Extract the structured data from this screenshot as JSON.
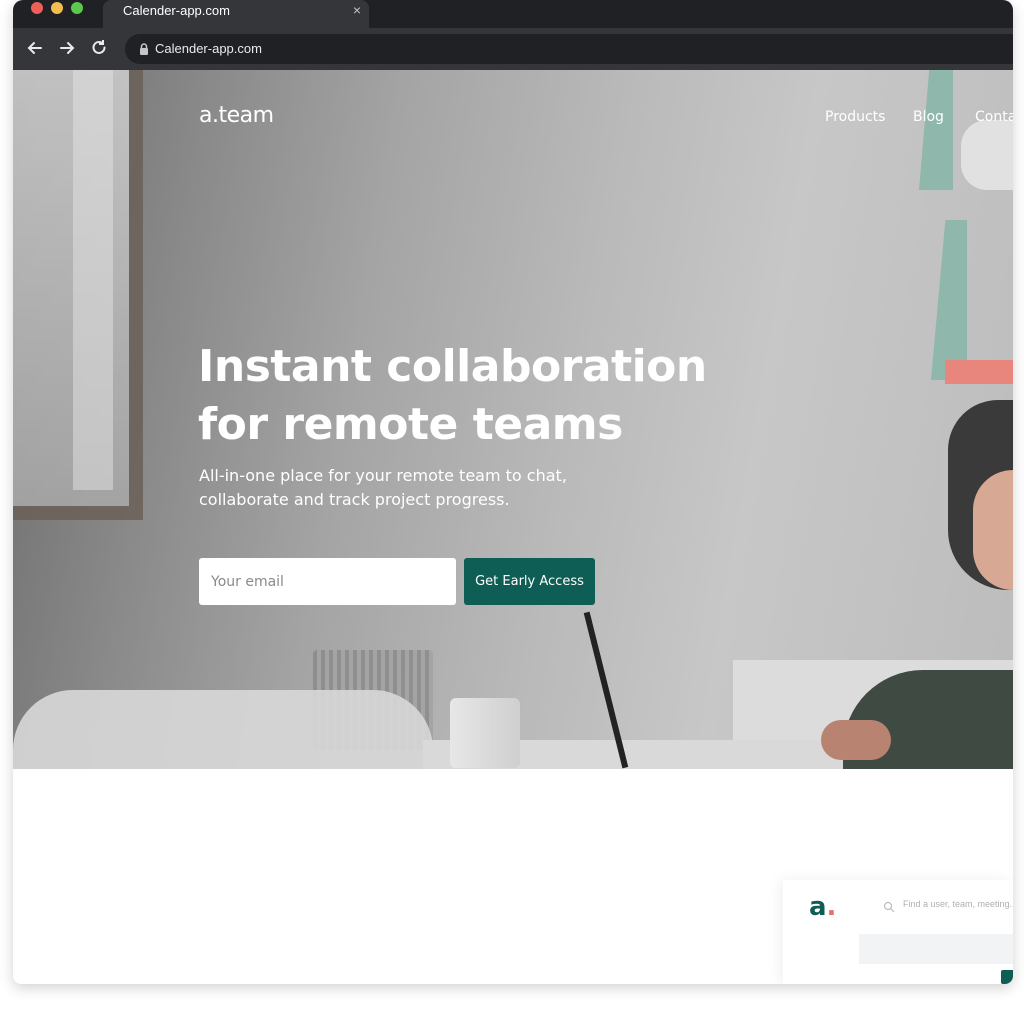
{
  "browser": {
    "tab_title": "Calender-app.com",
    "tab_close": "×",
    "url": "Calender-app.com"
  },
  "site": {
    "logo": "a.team",
    "nav": [
      "Products",
      "Blog",
      "Contact"
    ]
  },
  "hero": {
    "headline_line1": "Instant collaboration",
    "headline_line2": "for remote teams",
    "subhead_line1": "All-in-one place for your remote team to chat,",
    "subhead_line2": "collaborate and track project progress.",
    "email_placeholder": "Your email",
    "cta_label": "Get Early Access"
  },
  "preview": {
    "logo": "a",
    "logo_dot": ".",
    "search_placeholder": "Find a user, team, meeting..."
  },
  "colors": {
    "accent": "#0f5e55",
    "logo_dot": "#e8706a"
  }
}
